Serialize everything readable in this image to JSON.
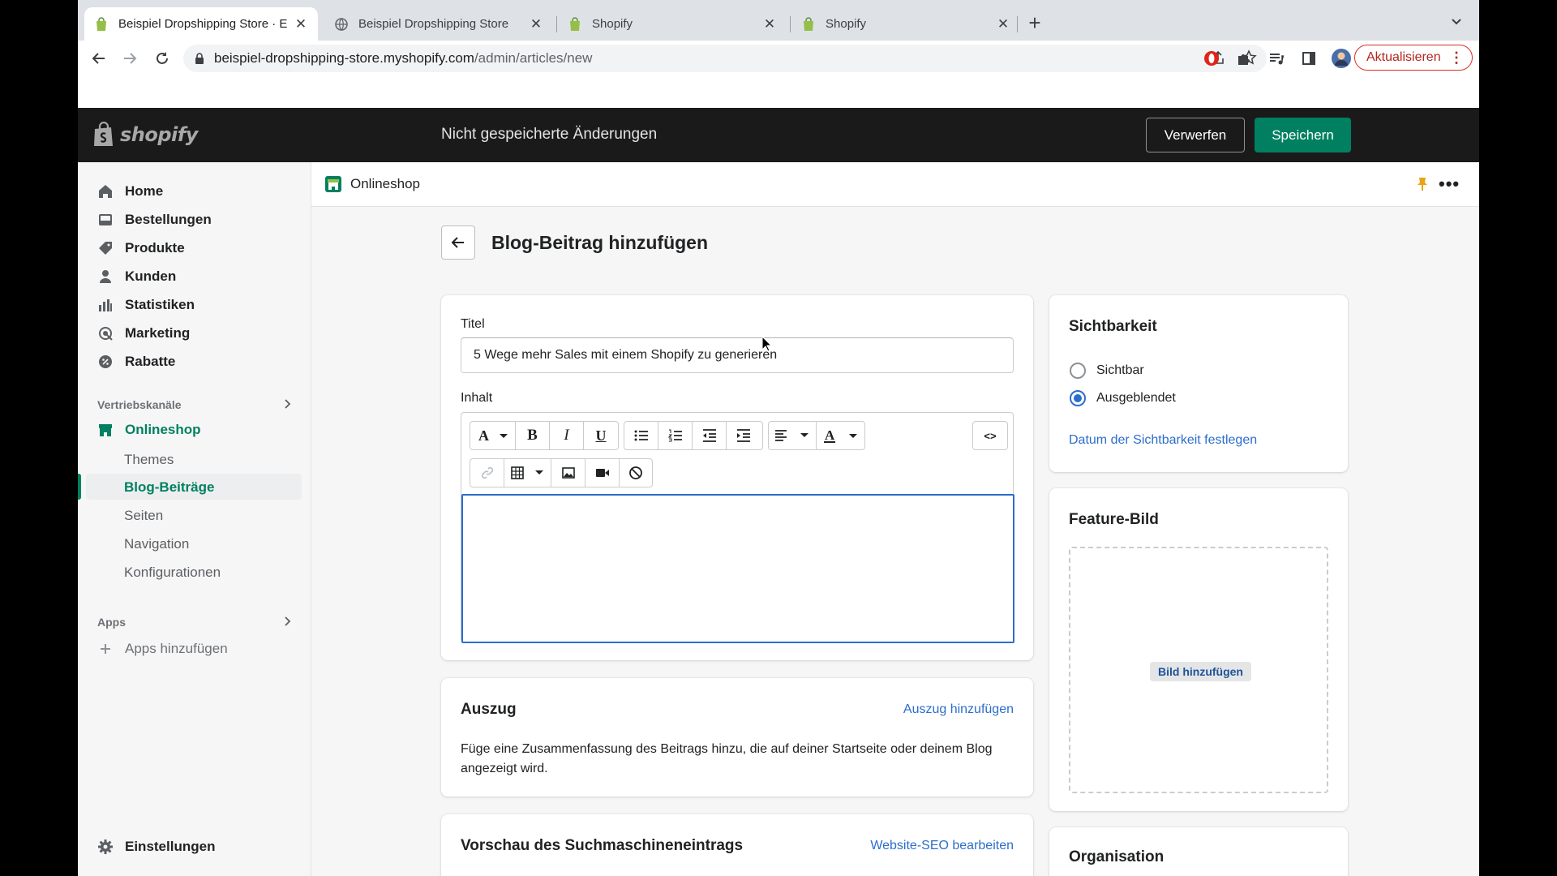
{
  "browser": {
    "tabs": [
      {
        "title": "Beispiel Dropshipping Store · E",
        "icon": "shopify-bag-icon",
        "active": true
      },
      {
        "title": "Beispiel Dropshipping Store",
        "icon": "globe-icon",
        "active": false
      },
      {
        "title": "Shopify",
        "icon": "shopify-bag-icon",
        "active": false
      },
      {
        "title": "Shopify",
        "icon": "shopify-bag-icon",
        "active": false
      }
    ],
    "url_host": "beispiel-dropshipping-store.myshopify.com",
    "url_path": "/admin/articles/new",
    "update_label": "Aktualisieren"
  },
  "topbar": {
    "logo_text": "shopify",
    "status": "Nicht gespeicherte Änderungen",
    "discard_label": "Verwerfen",
    "save_label": "Speichern"
  },
  "sidebar": {
    "items": [
      {
        "label": "Home",
        "icon": "home-icon"
      },
      {
        "label": "Bestellungen",
        "icon": "orders-icon"
      },
      {
        "label": "Produkte",
        "icon": "tag-icon"
      },
      {
        "label": "Kunden",
        "icon": "person-icon"
      },
      {
        "label": "Statistiken",
        "icon": "bar-chart-icon"
      },
      {
        "label": "Marketing",
        "icon": "target-icon"
      },
      {
        "label": "Rabatte",
        "icon": "discount-icon"
      }
    ],
    "channels_label": "Vertriebskanäle",
    "online_store_label": "Onlineshop",
    "sub_items": [
      "Themes",
      "Blog-Beiträge",
      "Seiten",
      "Navigation",
      "Konfigurationen"
    ],
    "selected_sub": "Blog-Beiträge",
    "apps_label": "Apps",
    "add_apps_label": "Apps hinzufügen",
    "settings_label": "Einstellungen"
  },
  "main": {
    "channel_name": "Onlineshop",
    "page_title": "Blog-Beitrag hinzufügen",
    "title_label": "Titel",
    "title_value": "5 Wege mehr Sales mit einem Shopify zu generieren",
    "content_label": "Inhalt",
    "excerpt": {
      "title": "Auszug",
      "action": "Auszug hinzufügen",
      "text": "Füge eine Zusammenfassung des Beitrags hinzu, die auf deiner Startseite oder deinem Blog angezeigt wird."
    },
    "seo": {
      "title": "Vorschau des Suchmaschineneintrags",
      "action": "Website-SEO bearbeiten"
    },
    "visibility": {
      "title": "Sichtbarkeit",
      "options": [
        "Sichtbar",
        "Ausgeblendet"
      ],
      "selected": "Ausgeblendet",
      "date_link": "Datum der Sichtbarkeit festlegen"
    },
    "feature_image": {
      "title": "Feature-Bild",
      "button": "Bild hinzufügen"
    },
    "organisation_title": "Organisation"
  },
  "colors": {
    "primary": "#008060",
    "link": "#2c6ecb",
    "topbar": "#1a1a1a"
  }
}
